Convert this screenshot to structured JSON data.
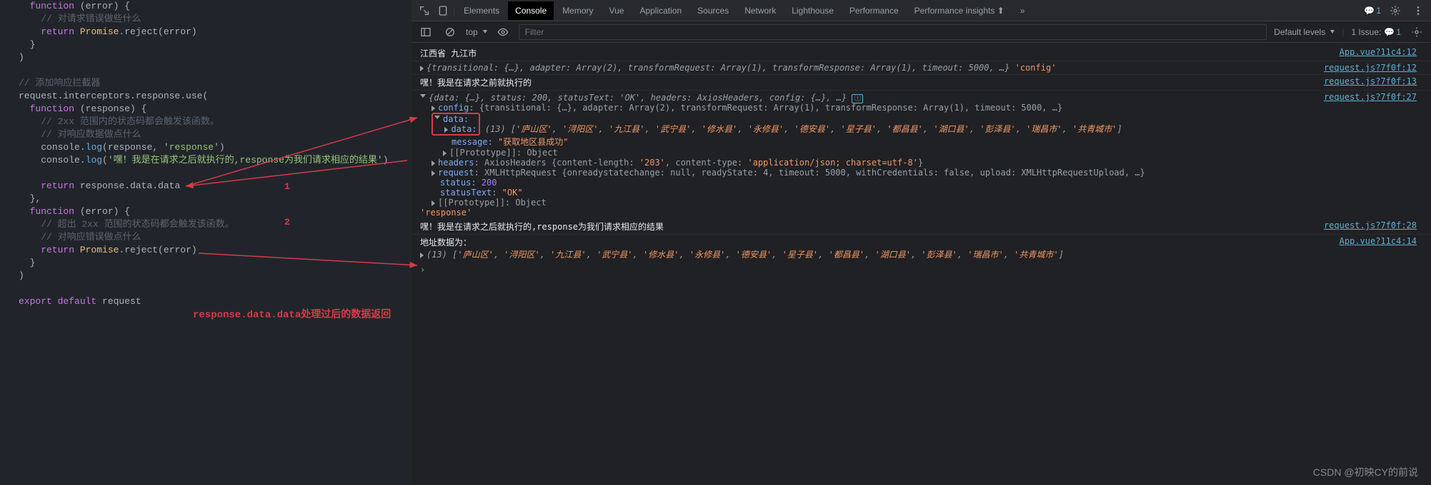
{
  "editor": {
    "l1_kw": "function",
    "l1_p": " (error) {",
    "l2_cm": "// 对请求错误做些什么",
    "l3_kw": "return",
    "l3_fn": " Promise",
    "l3_p": ".reject(error)",
    "l4": "}",
    "l5": ")",
    "l6_cm": "// 添加响应拦截器",
    "l7": "request.interceptors.response.use(",
    "l8_kw": "function",
    "l8_p": " (response) {",
    "l9_cm": "// 2xx 范围内的状态码都会触发该函数。",
    "l10_cm": "// 对响应数据做点什么",
    "l11_a": "console.",
    "l11_fn": "log",
    "l11_b": "(response, ",
    "l11_str": "'response'",
    "l11_c": ")",
    "l12_a": "console.",
    "l12_fn": "log",
    "l12_b": "(",
    "l12_str": "'嘿！我是在请求之后就执行的,response为我们请求相应的结果'",
    "l12_c": ")",
    "l13_kw": "return",
    "l13_p": " response.data.data",
    "l14": "},",
    "l15_kw": "function",
    "l15_p": " (error) {",
    "l16_cm": "// 超出 2xx 范围的状态码都会触发该函数。",
    "l17_cm": "// 对响应错误做点什么",
    "l18_kw": "return",
    "l18_fn": " Promise",
    "l18_p": ".reject(error)",
    "l19": "}",
    "l20": ")",
    "l21_kw": "export default",
    "l21_p": " request",
    "label1": "1",
    "label2": "2",
    "caption": "response.data.data处理过后的数据返回"
  },
  "tabs": {
    "elements": "Elements",
    "console": "Console",
    "memory": "Memory",
    "vue": "Vue",
    "application": "Application",
    "sources": "Sources",
    "network": "Network",
    "lighthouse": "Lighthouse",
    "performance": "Performance",
    "insights": "Performance insights",
    "more": "»",
    "msg_count": "1"
  },
  "toolbar": {
    "top": "top",
    "filter_ph": "Filter",
    "levels": "Default levels",
    "issue_label": "1 Issue:",
    "issue_count": "1"
  },
  "console": {
    "r0": "江西省 九江市",
    "r0_src": "App.vue?11c4:12",
    "r1_pre": "{transitional: {…}, adapter: Array(2), transformRequest: Array(1), transformResponse: Array(1), timeout: 5000, …}",
    "r1_tag": "'config'",
    "r1_src": "request.js?7f0f:12",
    "r2": "嘿！我是在请求之前就执行的",
    "r2_src": "request.js?7f0f:13",
    "r3_pre": "{data: {…}, status: 200, statusText: 'OK', headers: AxiosHeaders, config: {…}, …}",
    "r3_src": "request.js?7f0f:27",
    "r3_config_k": "config",
    "r3_config_v": ": {transitional: {…}, adapter: Array(2), transformRequest: Array(1), transformResponse: Array(1), timeout: 5000, …}",
    "r3_data_k": "data:",
    "r3_data2_k": "data:",
    "r3_data2_v": "(13) ['庐山区', '浔阳区', '九江县', '武宁县', '修水县', '永修县', '德安县', '星子县', '都昌县', '湖口县', '彭泽县', '瑞昌市', '共青城市']",
    "r3_msg_k": "message: ",
    "r3_msg_v": "\"获取地区县成功\"",
    "r3_proto": "[[Prototype]]: ",
    "r3_proto_v": "Object",
    "r3_headers_k": "headers",
    "r3_headers_v": ": AxiosHeaders {content-length: '203', content-type: 'application/json; charset=utf-8'}",
    "r3_request_k": "request",
    "r3_request_v": ": XMLHttpRequest {onreadystatechange: null, readyState: 4, timeout: 5000, withCredentials: false, upload: XMLHttpRequestUpload, …}",
    "r3_status_k": "status: ",
    "r3_status_v": "200",
    "r3_statustext_k": "statusText: ",
    "r3_statustext_v": "\"OK\"",
    "r3_proto2": "[[Prototype]]: ",
    "r3_proto2_v": "Object",
    "r3_tag": "'response'",
    "r4": "嘿！我是在请求之后就执行的,response为我们请求相应的结果",
    "r4_src": "request.js?7f0f:28",
    "r5": "地址数据为：",
    "r5_src": "App.vue?11c4:14",
    "r5_arr": "(13) ['庐山区', '浔阳区', '九江县', '武宁县', '修水县', '永修县', '德安县', '星子县', '都昌县', '湖口县', '彭泽县', '瑞昌市', '共青城市']",
    "prompt": "›"
  },
  "watermark": "CSDN @初映CY的前说"
}
